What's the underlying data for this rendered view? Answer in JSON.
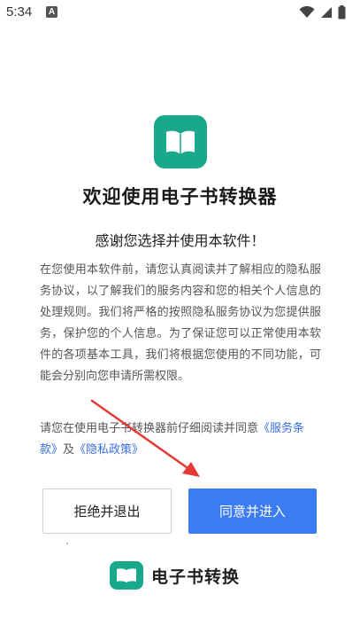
{
  "status_bar": {
    "time": "5:34",
    "notification_letter": "A"
  },
  "app": {
    "title": "欢迎使用电子书转换器",
    "subtitle": "感谢您选择并使用本软件！",
    "body": "在您使用本软件前，请您认真阅读并了解相应的隐私服务协议，以了解我们的服务内容和您的相关个人信息的处理规则。我们将严格的按照隐私服务协议为您提供服务，保护您的个人信息。为了保证您可以正常使用本软件的各项基本工具，我们将根据您使用的不同功能，可能会分别向您申请所需权限。",
    "agree_prefix": "请您在使用电子书转换器前仔细阅读并同意",
    "terms_link": "《服务条款》",
    "and": "及",
    "privacy_link": "《隐私政策》"
  },
  "buttons": {
    "reject": "拒绝并退出",
    "agree": "同意并进入"
  },
  "brand": {
    "name": "电子书转换"
  },
  "colors": {
    "brand_green": "#19a88a",
    "primary_blue": "#3b7cf2",
    "link_blue": "#3a6fe8",
    "arrow_red": "#e53935"
  }
}
